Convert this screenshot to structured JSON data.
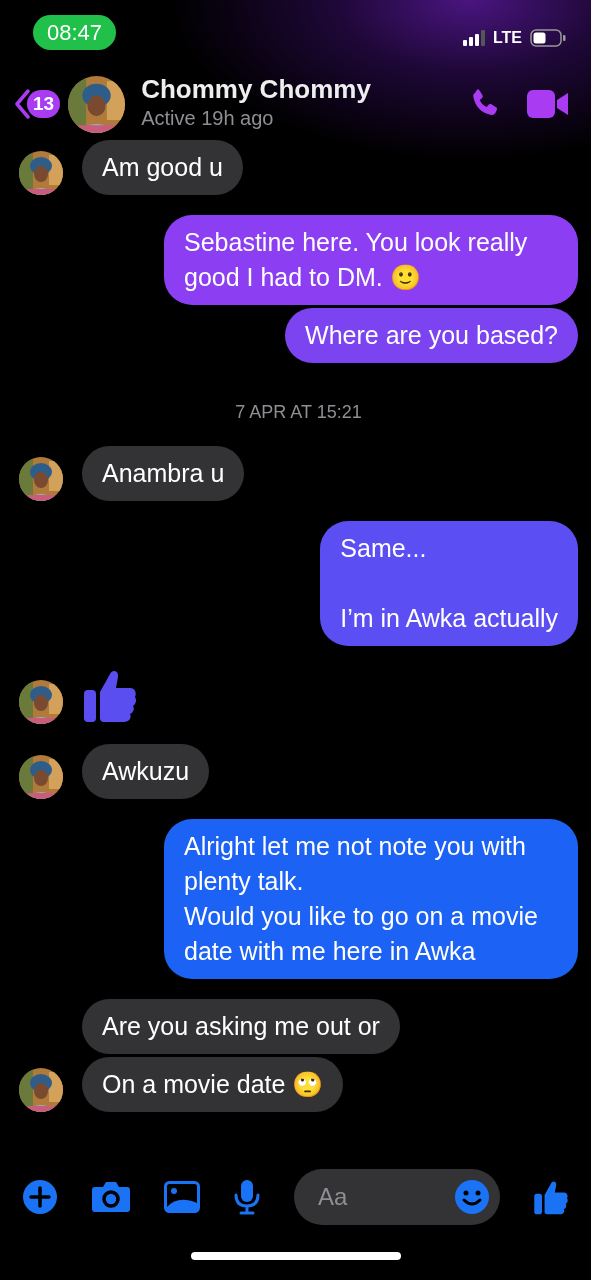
{
  "status_bar": {
    "time": "08:47",
    "network": "LTE"
  },
  "header": {
    "back_count": "13",
    "name": "Chommy Chommy",
    "presence": "Active 19h ago"
  },
  "messages": [
    {
      "kind": "incoming",
      "text": "Am good u",
      "show_avatar": true
    },
    {
      "kind": "outgoing",
      "text": "Sebastine here. You look really good I had to DM. 🙂",
      "color": "#8c3ff2"
    },
    {
      "kind": "outgoing",
      "text": "Where are you based?",
      "color": "#7b44f0"
    },
    {
      "kind": "timestamp",
      "text": "7 APR AT 15:21"
    },
    {
      "kind": "incoming",
      "text": "Anambra u",
      "show_avatar": true
    },
    {
      "kind": "outgoing",
      "text": "Same...\n\nI’m in Awka actually",
      "color": "#5b4ef2"
    },
    {
      "kind": "like",
      "show_avatar": true
    },
    {
      "kind": "incoming",
      "text": "Awkuzu",
      "show_avatar": true
    },
    {
      "kind": "outgoing",
      "text": "Alright let me not note you with plenty talk.\nWould you like to go on a movie date with me here in Awka",
      "color": "#1c62f4"
    },
    {
      "kind": "incoming",
      "text": "Are you asking me out or",
      "show_avatar": false
    },
    {
      "kind": "incoming",
      "text": "On a movie date 🙄",
      "show_avatar": true
    }
  ],
  "composer": {
    "placeholder": "Aa"
  }
}
